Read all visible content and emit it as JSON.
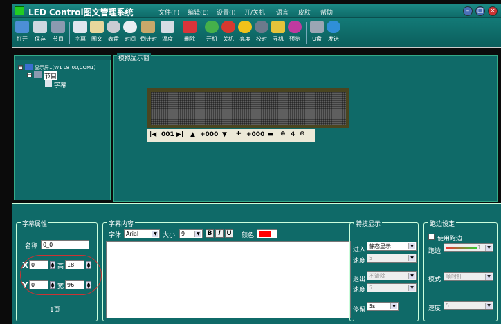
{
  "title": "LED Control图文管理系统",
  "menu": [
    "文件(F)",
    "编辑(E)",
    "设置(I)",
    "开/关机",
    "语言",
    "皮肤",
    "帮助"
  ],
  "toolbar": [
    "打开",
    "保存",
    "节目",
    "字幕",
    "图文",
    "表盘",
    "时间",
    "倒计时",
    "温度",
    "删除",
    "开机",
    "关机",
    "亮度",
    "校时",
    "寻机",
    "预览",
    "U盘",
    "发送"
  ],
  "tree": {
    "screen": "显示屏1(W1 L8_00,COM1)",
    "program": "节目",
    "item": "字幕"
  },
  "sim": {
    "label": "模拟显示窗",
    "page": "001",
    "x": "+000",
    "y": "+000",
    "zoom": "4"
  },
  "props": {
    "label": "字幕属性",
    "name_label": "名称",
    "name": "0_0",
    "x_label": "X",
    "x": "0",
    "y_label": "Y",
    "y": "0",
    "h_label": "高",
    "h": "18",
    "w_label": "宽",
    "w": "96",
    "page": "1页"
  },
  "content": {
    "label": "字幕内容",
    "font_label": "字体",
    "font": "Arial",
    "size_label": "大小",
    "size": "9",
    "color_label": "颜色",
    "b": "B",
    "i": "I",
    "u": "U"
  },
  "effect": {
    "label": "特技显示",
    "in_label": "进入",
    "in": "静态显示",
    "speed_label": "速度",
    "speed": "5",
    "out_label": "退出",
    "out": "不清除",
    "speed2_label": "速度",
    "speed2": "5",
    "stay_label": "停留",
    "stay": "5s"
  },
  "border": {
    "label": "跑边设定",
    "use_label": "使用跑边",
    "edge_label": "跑边",
    "edge_val": "1",
    "mode_label": "模式",
    "mode": "顺时针",
    "speed_label": "速度",
    "speed": "5"
  },
  "colors": {
    "accent": "#ff0000",
    "panel": "#0f6a68"
  }
}
